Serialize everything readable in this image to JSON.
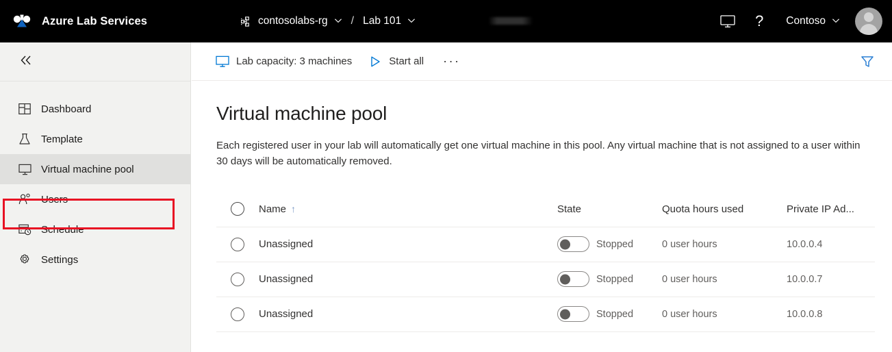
{
  "header": {
    "logo_icon": "azure-lab-services-logo",
    "brand": "Azure Lab Services",
    "breadcrumb": {
      "resource_group_icon": "resource-group-icon",
      "resource_group": "contosolabs-rg",
      "separator": "/",
      "lab": "Lab 101",
      "chevron_icon": "chevron-down-icon"
    },
    "redacted_item": "",
    "monitor_icon": "monitor-icon",
    "help_label": "?",
    "tenant": "Contoso",
    "avatar_icon": "user-avatar"
  },
  "sidebar": {
    "collapse_icon": "double-chevron-left-icon",
    "items": [
      {
        "label": "Dashboard",
        "icon": "dashboard-icon",
        "selected": false
      },
      {
        "label": "Template",
        "icon": "flask-icon",
        "selected": false
      },
      {
        "label": "Virtual machine pool",
        "icon": "monitor-icon",
        "selected": true
      },
      {
        "label": "Users",
        "icon": "user-icon",
        "selected": false
      },
      {
        "label": "Schedule",
        "icon": "calendar-clock-icon",
        "selected": false
      },
      {
        "label": "Settings",
        "icon": "gear-icon",
        "selected": false
      }
    ],
    "highlight_color": "#e81123"
  },
  "commandbar": {
    "capacity_icon": "monitor-icon",
    "capacity_label": "Lab capacity: 3 machines",
    "start_icon": "play-icon",
    "start_label": "Start all",
    "more_label": "···",
    "filter_icon": "filter-icon",
    "filter_color": "#0078d4"
  },
  "main": {
    "title": "Virtual machine pool",
    "description": "Each registered user in your lab will automatically get one virtual machine in this pool. Any virtual machine that is not assigned to a user within 30 days will be automatically removed."
  },
  "table": {
    "columns": {
      "name": "Name",
      "sort_indicator": "↑",
      "state": "State",
      "quota": "Quota hours used",
      "ip": "Private IP Ad..."
    },
    "rows": [
      {
        "name": "Unassigned",
        "toggle_on": false,
        "state": "Stopped",
        "quota": "0 user hours",
        "ip": "10.0.0.4"
      },
      {
        "name": "Unassigned",
        "toggle_on": false,
        "state": "Stopped",
        "quota": "0 user hours",
        "ip": "10.0.0.7"
      },
      {
        "name": "Unassigned",
        "toggle_on": false,
        "state": "Stopped",
        "quota": "0 user hours",
        "ip": "10.0.0.8"
      }
    ]
  }
}
